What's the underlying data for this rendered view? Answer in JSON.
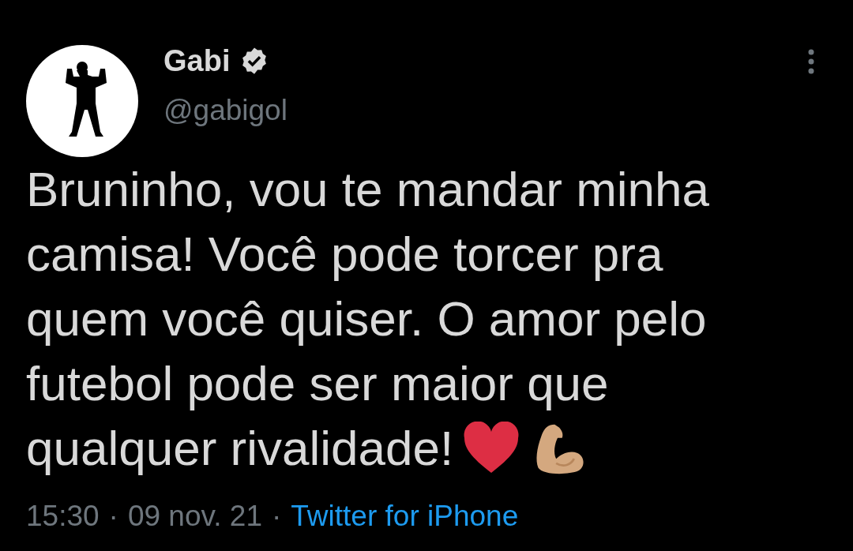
{
  "author": {
    "name": "Gabi",
    "verified": true,
    "handle": "@gabigol"
  },
  "tweet": {
    "lines": [
      "Bruninho, vou te mandar minha",
      "camisa! Você pode torcer pra",
      "quem você quiser. O amor pelo",
      "futebol pode ser maior que",
      "qualquer rivalidade!"
    ]
  },
  "meta": {
    "time": "15:30",
    "separator_1": "·",
    "date": "09 nov. 21",
    "separator_2": "·",
    "source": "Twitter for iPhone"
  }
}
